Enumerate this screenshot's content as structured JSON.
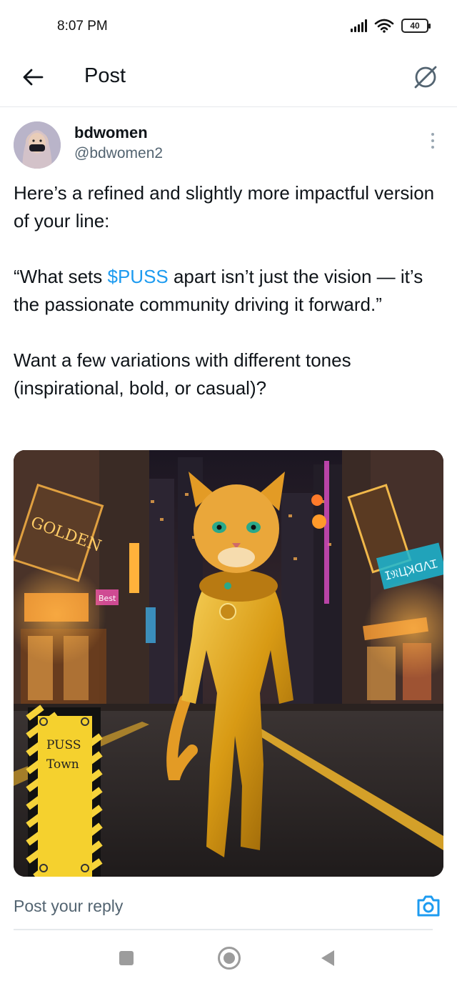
{
  "status_bar": {
    "time": "8:07 PM",
    "battery": "40"
  },
  "header": {
    "title": "Post"
  },
  "post": {
    "author_name": "bdwomen",
    "author_handle": "@bdwomen2",
    "text_line1": "Here’s a refined and slightly more impactful version of your line:",
    "quote_open": "“What sets ",
    "cashtag": "$PUSS",
    "quote_rest": " apart isn’t just the vision — it’s the passionate community driving it forward.”",
    "text_line3": "Want a few variations with different tones (inspirational, bold, or casual)?",
    "image": {
      "sign_left": "GOLDEN",
      "sign_right": "ⵊ𝔑ЦꓘꓷⴷꞮ",
      "banner_line1": "PUSS",
      "banner_line2": "Town",
      "sign_small": "Best"
    }
  },
  "reply": {
    "placeholder": "Post your reply"
  },
  "icons": {
    "back": "arrow-left-icon",
    "grok": "grok-icon",
    "more": "more-vertical-icon",
    "camera": "camera-icon",
    "wifi": "wifi-icon",
    "signal": "signal-icon",
    "battery": "battery-icon"
  },
  "colors": {
    "accent": "#1d9bf0",
    "text": "#0f1419",
    "secondary": "#536471"
  }
}
